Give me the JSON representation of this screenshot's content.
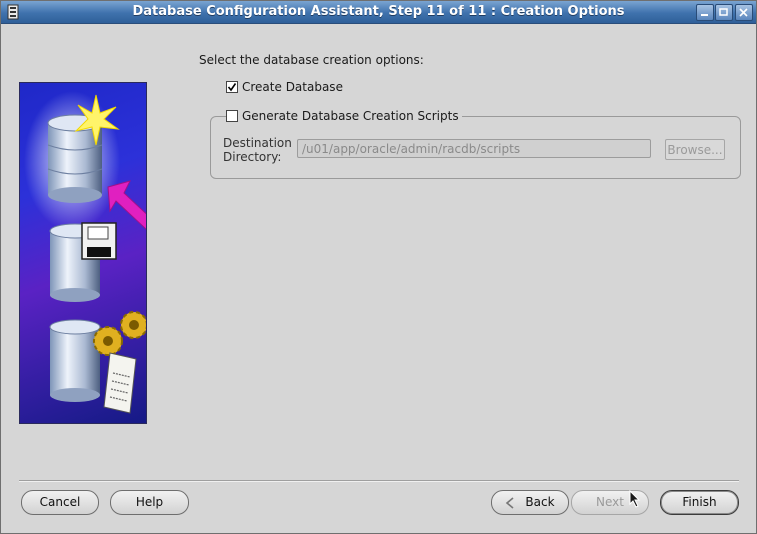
{
  "window": {
    "title": "Database Configuration Assistant, Step 11 of 11 : Creation Options",
    "controls": [
      "minimize-icon",
      "maximize-icon",
      "close-icon"
    ]
  },
  "main": {
    "prompt": "Select the database creation options:",
    "create_database": {
      "label": "Create Database",
      "checked": true
    },
    "generate_scripts": {
      "label": "Generate Database Creation Scripts",
      "checked": false
    },
    "destination": {
      "label_line1": "Destination",
      "label_line2": "Directory:",
      "value": "/u01/app/oracle/admin/racdb/scripts",
      "browse_label": "Browse..."
    }
  },
  "footer": {
    "cancel_label": "Cancel",
    "help_label": "Help",
    "back_label": "Back",
    "next_label": "Next",
    "finish_label": "Finish"
  },
  "colors": {
    "title_bar": "#3f72ad",
    "window_bg": "#d6d6d6",
    "art_panel": "#2c31d9",
    "arrow": "#e020c0",
    "star": "#fff46a"
  }
}
